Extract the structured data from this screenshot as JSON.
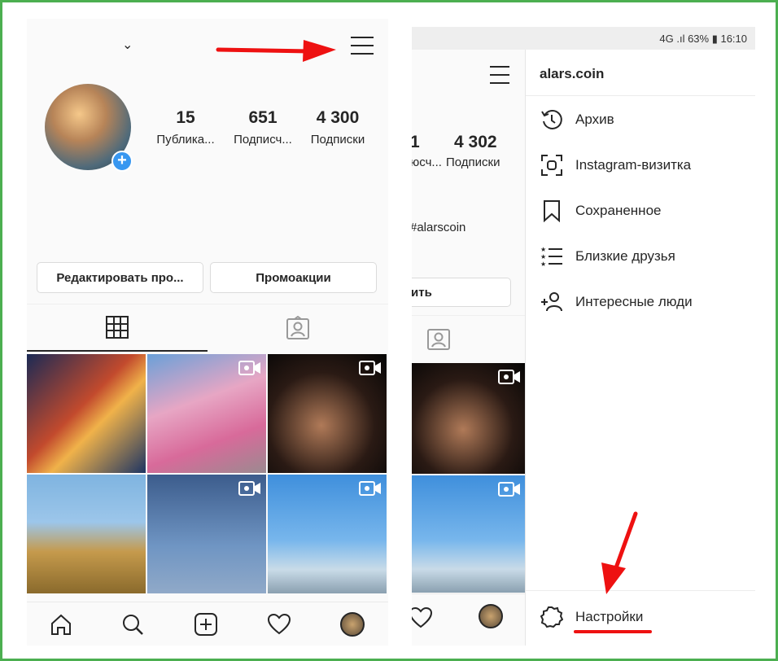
{
  "left": {
    "profile": {
      "stats": [
        {
          "num": "15",
          "label": "Публика..."
        },
        {
          "num": "651",
          "label": "Подписч..."
        },
        {
          "num": "4 300",
          "label": "Подписки"
        }
      ]
    },
    "buttons": {
      "edit": "Редактировать про...",
      "promo": "Промоакции"
    }
  },
  "right": {
    "status": {
      "text": "4G .ıl 63% ▮ 16:10"
    },
    "under": {
      "stat1_num": "1",
      "stat2_num": "4 302",
      "stat1_label": "юсч...",
      "stat2_label": "Подписки",
      "tag": "#alarscoin",
      "button_fragment": "ить"
    },
    "drawer": {
      "title": "alars.coin",
      "items": [
        {
          "label": "Архив",
          "icon": "archive-icon"
        },
        {
          "label": "Instagram-визитка",
          "icon": "nametag-icon"
        },
        {
          "label": "Сохраненное",
          "icon": "bookmark-icon"
        },
        {
          "label": "Близкие друзья",
          "icon": "close-friends-icon"
        },
        {
          "label": "Интересные люди",
          "icon": "add-person-icon"
        }
      ],
      "settings": "Настройки"
    }
  },
  "colors": {
    "accent_blue": "#3897f0",
    "arrow_red": "#e11"
  }
}
